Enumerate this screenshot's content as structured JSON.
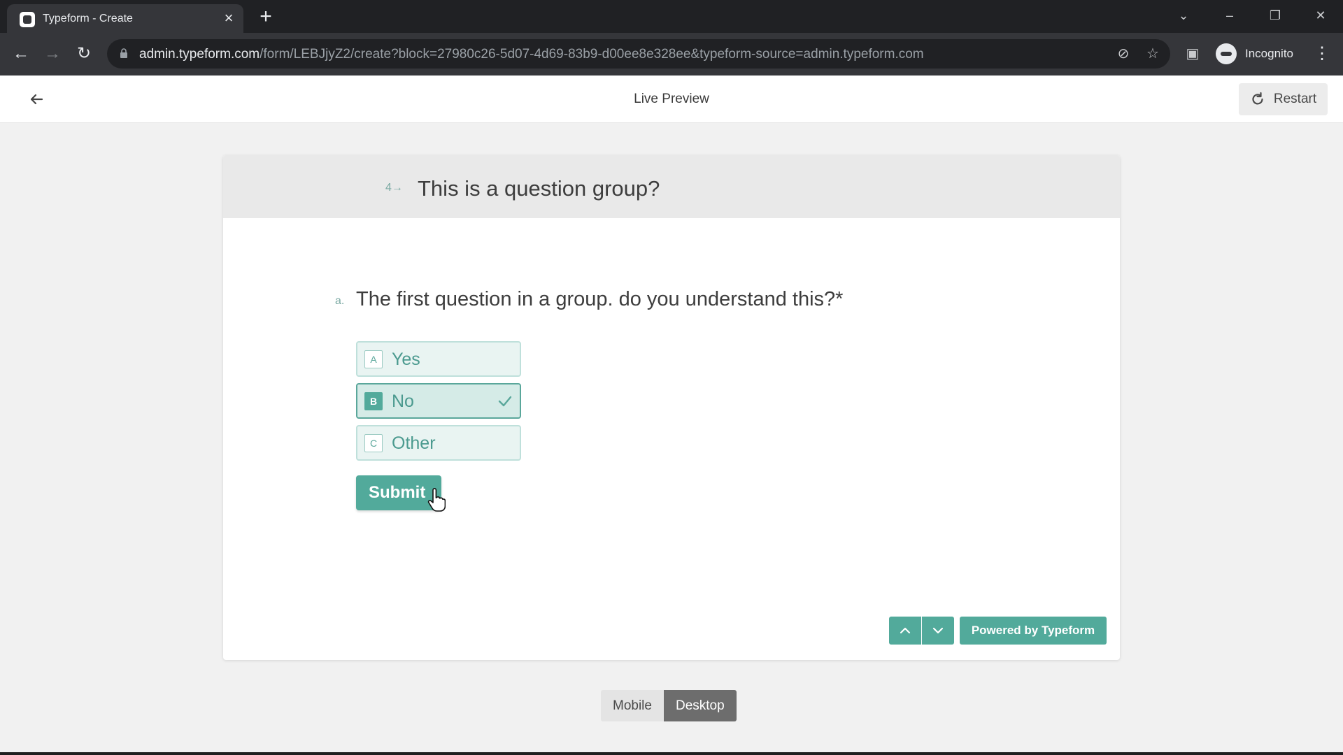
{
  "browser": {
    "tab_title": "Typeform - Create",
    "url_host": "admin.typeform.com",
    "url_path": "/form/LEBJjyZ2/create?block=27980c26-5d07-4d69-83b9-d00ee8e328ee&typeform-source=admin.typeform.com",
    "profile_label": "Incognito"
  },
  "header": {
    "title": "Live Preview",
    "restart_label": "Restart"
  },
  "form": {
    "group_number": "4",
    "group_title": "This is a question group?",
    "question_letter": "a.",
    "question_text": "The first question in a group. do you understand this?*",
    "choices": [
      {
        "key": "A",
        "label": "Yes",
        "selected": false
      },
      {
        "key": "B",
        "label": "No",
        "selected": true
      },
      {
        "key": "C",
        "label": "Other",
        "selected": false
      }
    ],
    "submit_label": "Submit",
    "powered_label": "Powered by Typeform"
  },
  "device_toggle": {
    "mobile_label": "Mobile",
    "desktop_label": "Desktop",
    "active": "Desktop"
  },
  "colors": {
    "accent": "#52aa9b",
    "choice_bg": "#e9f4f2",
    "chrome_dark": "#202124",
    "chrome_toolbar": "#35363a"
  }
}
